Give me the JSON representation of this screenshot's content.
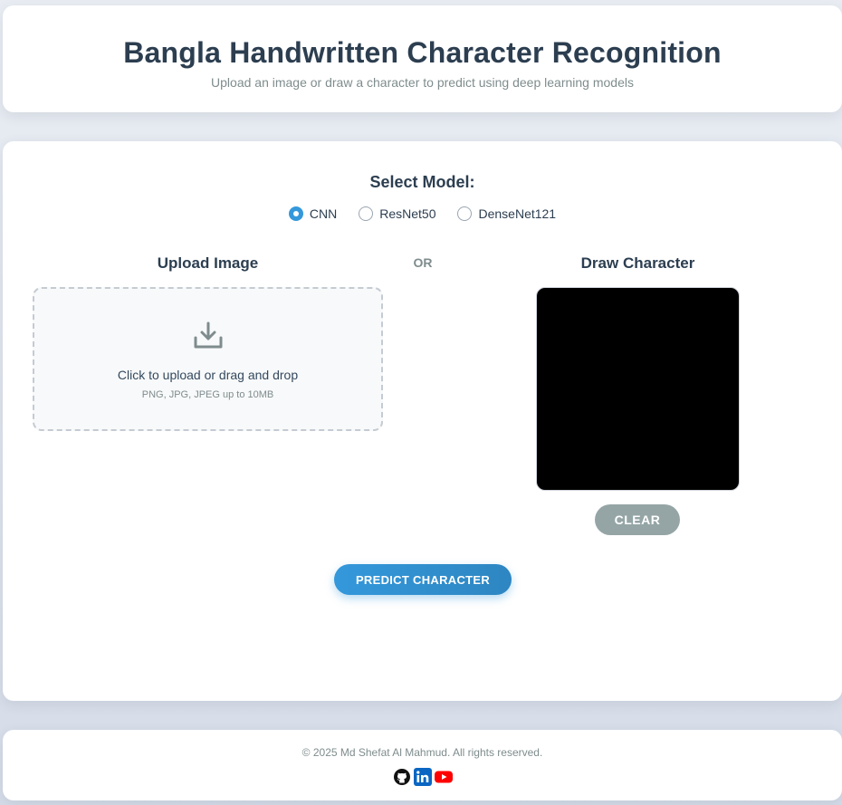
{
  "header": {
    "title": "Bangla Handwritten Character Recognition",
    "subtitle": "Upload an image or draw a character to predict using deep learning models"
  },
  "model_select": {
    "title": "Select Model:",
    "options": [
      {
        "label": "CNN",
        "checked": true
      },
      {
        "label": "ResNet50",
        "checked": false
      },
      {
        "label": "DenseNet121",
        "checked": false
      }
    ]
  },
  "upload": {
    "title": "Upload Image",
    "main_text": "Click to upload or drag and drop",
    "sub_text": "PNG, JPG, JPEG up to 10MB",
    "icon": "download-icon"
  },
  "separator": "OR",
  "draw": {
    "title": "Draw Character",
    "clear_label": "CLEAR"
  },
  "predict_label": "PREDICT CHARACTER",
  "footer": {
    "copyright": "© 2025 Md Shefat Al Mahmud. All rights reserved.",
    "social": [
      "github-icon",
      "linkedin-icon",
      "youtube-icon"
    ]
  },
  "colors": {
    "accent": "#3498db",
    "heading": "#2c3e50",
    "muted": "#7f8c8d",
    "clear_button": "#95a5a6"
  }
}
